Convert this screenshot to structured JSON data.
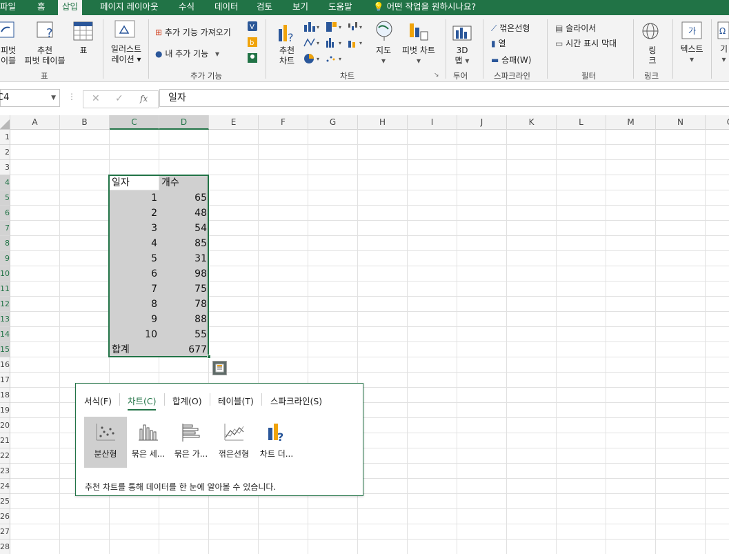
{
  "tabs": [
    "파일",
    "홈",
    "삽입",
    "페이지 레이아웃",
    "수식",
    "데이터",
    "검토",
    "보기",
    "도움말"
  ],
  "tell_me": "어떤 작업을 원하시나요?",
  "ribbon": {
    "pivot_label_1": "피벗",
    "pivot_label_2": "이블",
    "rec_pivot_1": "추천",
    "rec_pivot_2": "피벗 테이블",
    "table_label": "표",
    "group_table": "표",
    "illustrations_1": "일러스트",
    "illustrations_2": "레이션",
    "get_addins": "추가 기능 가져오기",
    "my_addins": "내 추가 기능",
    "group_addins": "추가 기능",
    "rec_charts_1": "추천",
    "rec_charts_2": "차트",
    "map_label": "지도",
    "pivot_chart": "피벗 차트",
    "group_charts": "차트",
    "map3d_1": "3D",
    "map3d_2": "맵",
    "group_tours": "투어",
    "sp_line": "꺾은선형",
    "sp_column": "열",
    "sp_winloss": "승패(W)",
    "group_sparklines": "스파크라인",
    "slicer": "슬라이서",
    "timeline": "시간 표시 막대",
    "group_filters": "필터",
    "link_1": "링",
    "link_2": "크",
    "group_links": "링크",
    "text_label": "텍스트",
    "more_label": "기"
  },
  "namebox": "C4",
  "formula_fx": "fx",
  "formula_value": "일자",
  "columns": [
    "A",
    "B",
    "C",
    "D",
    "E",
    "F",
    "G",
    "H",
    "I",
    "J",
    "K",
    "L",
    "M",
    "N",
    "O"
  ],
  "rows": [
    "1",
    "2",
    "3",
    "4",
    "5",
    "6",
    "7",
    "8",
    "9",
    "10",
    "11",
    "12",
    "13",
    "14",
    "15",
    "16",
    "17",
    "18",
    "19",
    "20",
    "21",
    "22",
    "23",
    "24",
    "25",
    "26",
    "27",
    "28"
  ],
  "table": {
    "header_date": "일자",
    "header_count": "개수",
    "rows": [
      {
        "day": "1",
        "count": "65"
      },
      {
        "day": "2",
        "count": "48"
      },
      {
        "day": "3",
        "count": "54"
      },
      {
        "day": "4",
        "count": "85"
      },
      {
        "day": "5",
        "count": "31"
      },
      {
        "day": "6",
        "count": "98"
      },
      {
        "day": "7",
        "count": "75"
      },
      {
        "day": "8",
        "count": "78"
      },
      {
        "day": "9",
        "count": "88"
      },
      {
        "day": "10",
        "count": "55"
      }
    ],
    "total_label": "합계",
    "total_value": "677"
  },
  "quick_analysis": {
    "tabs": [
      "서식(F)",
      "차트(C)",
      "합계(O)",
      "테이블(T)",
      "스파크라인(S)"
    ],
    "active_tab": "차트(C)",
    "buttons": [
      "분산형",
      "묶은 세...",
      "묶은 가...",
      "꺾은선형",
      "차트 더..."
    ],
    "description": "추천 차트를 통해 데이터를 한 눈에 알아볼 수 있습니다."
  },
  "colors": {
    "accent": "#217346",
    "selection": "#d0d0d0"
  }
}
